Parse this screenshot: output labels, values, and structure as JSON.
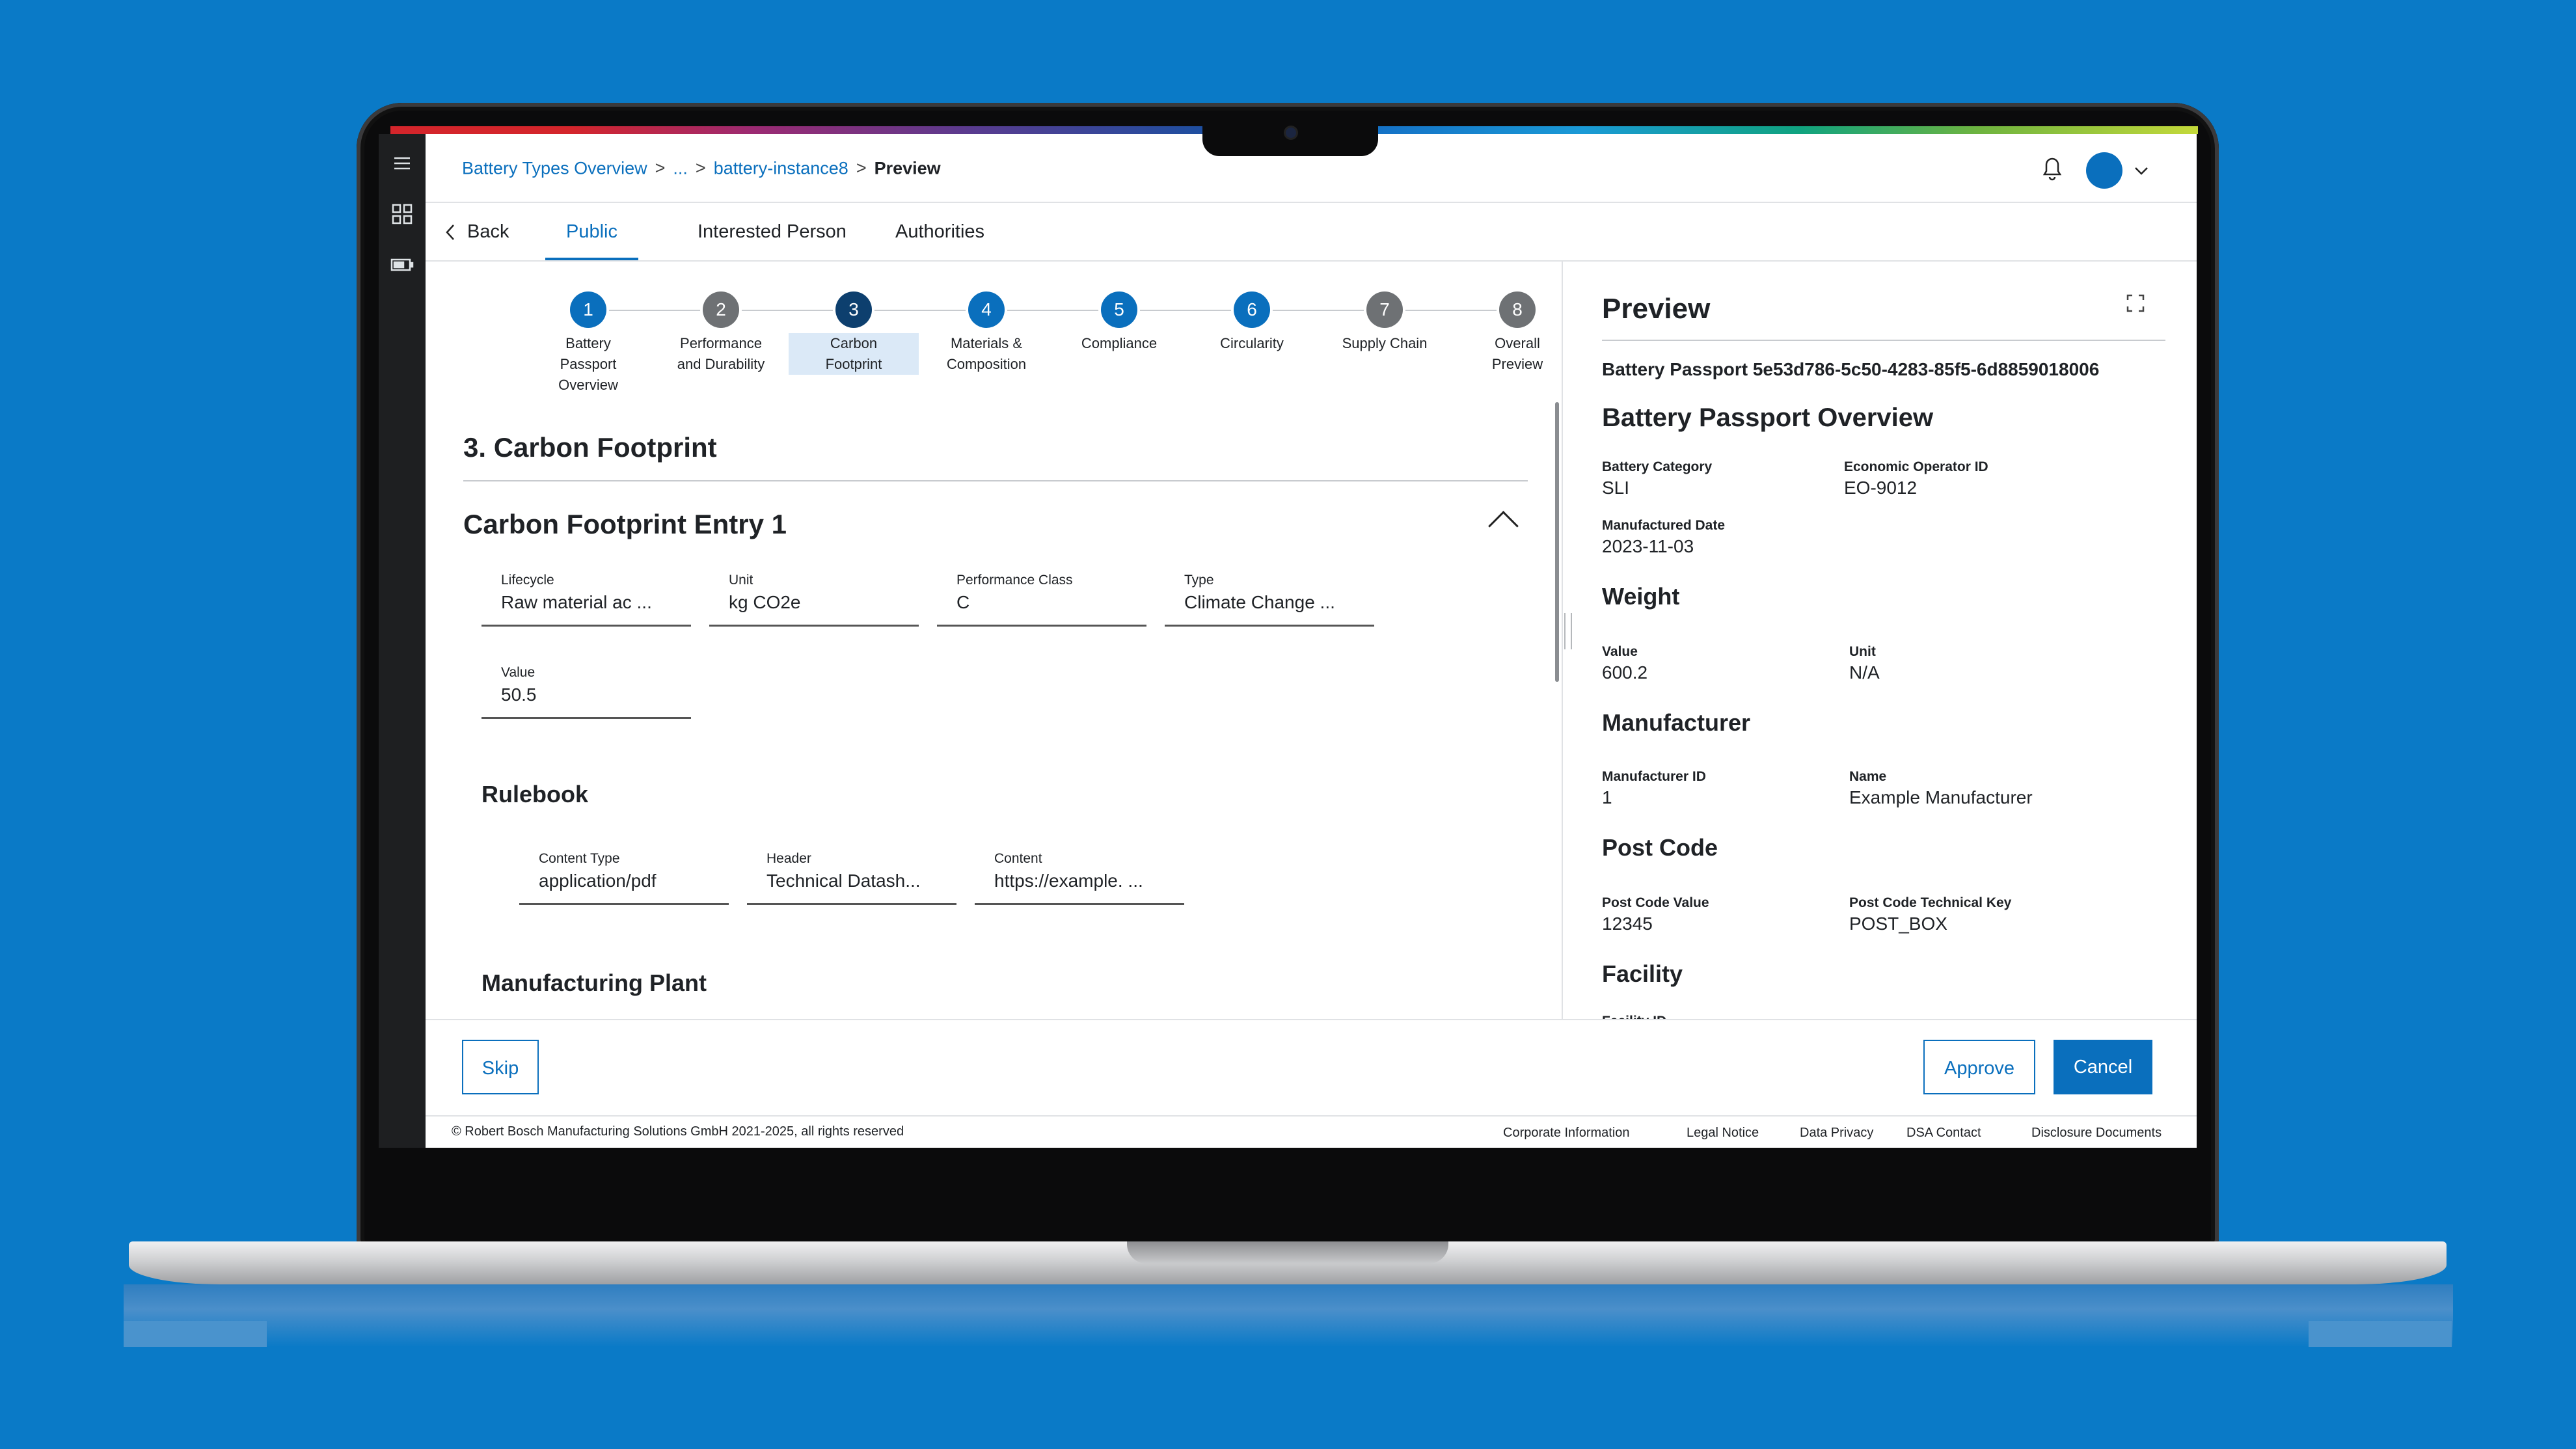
{
  "colors": {
    "brand": "#0a6fbd",
    "step_active": "#0a6fbd",
    "step_current": "#0d3f6e",
    "step_inactive": "#6e7174",
    "background": "#0a7ac7"
  },
  "sidebar": {
    "icons": [
      "menu-icon",
      "grid-icon",
      "battery-icon"
    ]
  },
  "breadcrumb": {
    "item1": "Battery Types Overview",
    "sep": ">",
    "ellipsis": "...",
    "item3": "battery-instance8",
    "current": "Preview"
  },
  "header": {
    "notifications_icon": "bell-icon",
    "avatar_icon": "avatar"
  },
  "tabs": {
    "back": "Back",
    "items": [
      "Public",
      "Interested Person",
      "Authorities"
    ],
    "active": "Public"
  },
  "stepper": {
    "steps": [
      {
        "num": "1",
        "label1": "Battery",
        "label2": "Passport",
        "label3": "Overview",
        "state": "done"
      },
      {
        "num": "2",
        "label1": "Performance",
        "label2": "and Durability",
        "label3": "",
        "state": "inactive"
      },
      {
        "num": "3",
        "label1": "Carbon",
        "label2": "Footprint",
        "label3": "",
        "state": "current"
      },
      {
        "num": "4",
        "label1": "Materials &",
        "label2": "Composition",
        "label3": "",
        "state": "done"
      },
      {
        "num": "5",
        "label1": "Compliance",
        "label2": "",
        "label3": "",
        "state": "done"
      },
      {
        "num": "6",
        "label1": "Circularity",
        "label2": "",
        "label3": "",
        "state": "done"
      },
      {
        "num": "7",
        "label1": "Supply Chain",
        "label2": "",
        "label3": "",
        "state": "inactive"
      },
      {
        "num": "8",
        "label1": "Overall",
        "label2": "Preview",
        "label3": "",
        "state": "inactive"
      }
    ]
  },
  "section": {
    "title": "3. Carbon Footprint",
    "entry_title": "Carbon Footprint Entry 1",
    "fields": {
      "lifecycle": {
        "label": "Lifecycle",
        "value": "Raw material ac  ..."
      },
      "unit": {
        "label": "Unit",
        "value": "kg CO2e"
      },
      "performance_class": {
        "label": "Performance Class",
        "value": "C"
      },
      "type": {
        "label": "Type",
        "value": "Climate Change  ..."
      },
      "value": {
        "label": "Value",
        "value": "50.5"
      }
    },
    "rulebook": {
      "title": "Rulebook",
      "content_type": {
        "label": "Content Type",
        "value": "application/pdf"
      },
      "header": {
        "label": "Header",
        "value": "Technical Datash..."
      },
      "content": {
        "label": "Content",
        "value": "https://example. ..."
      }
    },
    "manufacturing_plant": {
      "title": "Manufacturing Plant"
    }
  },
  "preview": {
    "title": "Preview",
    "passport_id": "Battery Passport 5e53d786-5c50-4283-85f5-6d8859018006",
    "overview_title": "Battery Passport Overview",
    "battery_category": {
      "label": "Battery Category",
      "value": "SLI"
    },
    "economic_operator": {
      "label": "Economic Operator ID",
      "value": "EO-9012"
    },
    "manufactured_date": {
      "label": "Manufactured Date",
      "value": "2023-11-03"
    },
    "weight": {
      "title": "Weight",
      "value_label": "Value",
      "value": "600.2",
      "unit_label": "Unit",
      "unit": "N/A"
    },
    "manufacturer": {
      "title": "Manufacturer",
      "id_label": "Manufacturer ID",
      "id": "1",
      "name_label": "Name",
      "name": "Example Manufacturer"
    },
    "post_code": {
      "title": "Post Code",
      "value_label": "Post Code Value",
      "value": "12345",
      "key_label": "Post Code Technical Key",
      "key": "POST_BOX"
    },
    "facility": {
      "title": "Facility",
      "id_label": "Facility ID"
    }
  },
  "actions": {
    "skip": "Skip",
    "approve": "Approve",
    "cancel": "Cancel"
  },
  "footer": {
    "copyright": "© Robert Bosch Manufacturing Solutions GmbH 2021-2025, all rights reserved",
    "links": [
      "Corporate Information",
      "Legal Notice",
      "Data Privacy",
      "DSA Contact",
      "Disclosure Documents"
    ]
  }
}
